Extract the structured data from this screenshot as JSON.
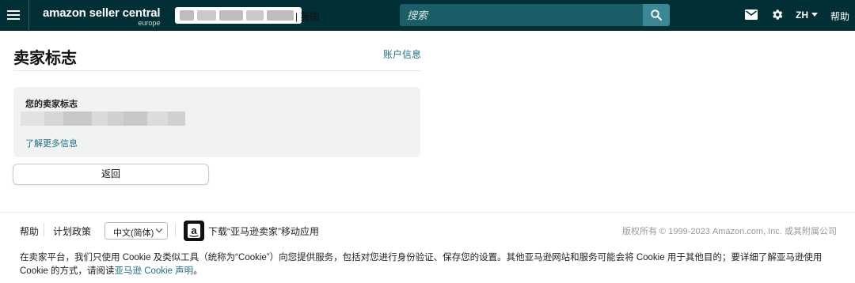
{
  "header": {
    "logo_main": "amazon seller central",
    "logo_sub": "europe",
    "account_marketplace": "| 英国",
    "search_placeholder": "搜索",
    "language": "ZH",
    "help": "帮助"
  },
  "page": {
    "title": "卖家标志",
    "account_info_link": "账户信息",
    "card_title": "您的卖家标志",
    "learn_more": "了解更多信息",
    "back_button": "返回"
  },
  "footer": {
    "help": "帮助",
    "policy": "计划政策",
    "language_select": "中文(简体)",
    "app_download": "下载“亚马逊卖家”移动应用",
    "copyright": "版权所有 © 1999-2023 Amazon.com, Inc. 或其附属公司",
    "cookie_text": "在卖家平台，我们只使用 Cookie 及类似工具（统称为“Cookie”）向您提供服务，包括对您进行身份验证、保存您的设置。其他亚马逊网站和服务可能会将 Cookie 用于其他目的；要详细了解亚马逊使用 Cookie 的方式，请阅读",
    "cookie_link": "亚马逊 Cookie 声明",
    "cookie_end": "。"
  },
  "colors": {
    "header_bg": "#002f36",
    "search_bg": "#1c5e68",
    "search_button": "#3a8896",
    "link": "#1e6f86"
  },
  "icons": [
    "menu-icon",
    "search-icon",
    "mail-icon",
    "gear-icon",
    "chevron-down-icon",
    "amazon-app-icon"
  ]
}
